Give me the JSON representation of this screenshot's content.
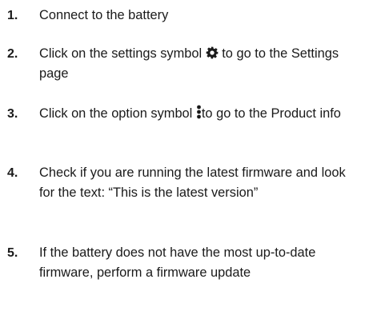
{
  "steps": [
    {
      "number": "1.",
      "text": "Connect to the battery"
    },
    {
      "number": "2.",
      "before_icon": "Click on the settings symbol ",
      "icon": "gear-icon",
      "after_icon": " to go to the Settings page"
    },
    {
      "number": "3.",
      "before_icon": "Click on the option symbol ",
      "icon": "kebab-icon",
      "after_icon": "to go to the Product info"
    },
    {
      "number": "4.",
      "text": "Check if you are running the latest firmware and look for the text: “This is the latest version”"
    },
    {
      "number": "5.",
      "text": "If the battery does not have the most up-to-date firmware, perform a firmware update"
    }
  ]
}
